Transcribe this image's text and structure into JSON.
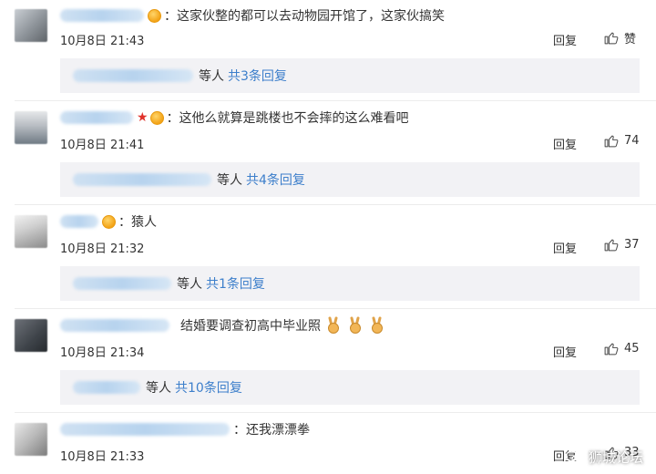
{
  "comments": [
    {
      "text": "：这家伙整的都可以去动物园开馆了，这家伙搞笑",
      "time": "10月8日 21:43",
      "reply_label": "回复",
      "like_count": "赞",
      "replies_suffix": "等人",
      "replies_link": "共3条回复"
    },
    {
      "text": "：这他么就算是跳楼也不会摔的这么难看吧",
      "time": "10月8日 21:41",
      "reply_label": "回复",
      "like_count": "74",
      "replies_suffix": "等人",
      "replies_link": "共4条回复"
    },
    {
      "text": "：猿人",
      "time": "10月8日 21:32",
      "reply_label": "回复",
      "like_count": "37",
      "replies_suffix": "等人",
      "replies_link": "共1条回复"
    },
    {
      "text": "结婚要调查初高中毕业照",
      "time": "10月8日 21:34",
      "reply_label": "回复",
      "like_count": "45",
      "replies_suffix": "等人",
      "replies_link": "共10条回复"
    },
    {
      "text": "：还我漂漂拳",
      "time": "10月8日 21:33",
      "reply_label": "回复",
      "like_count": "33"
    }
  ],
  "watermark": "狮城论坛",
  "colors": {
    "link": "#3d7fcb",
    "reply_bg": "#f2f2f5",
    "badge": "#f3a316",
    "star": "#e0322b"
  },
  "icons": {
    "like": "thumbs-up-icon",
    "vip": "vip-badge-icon",
    "star": "red-star-icon",
    "emoji": "victory-hand-emoji"
  }
}
